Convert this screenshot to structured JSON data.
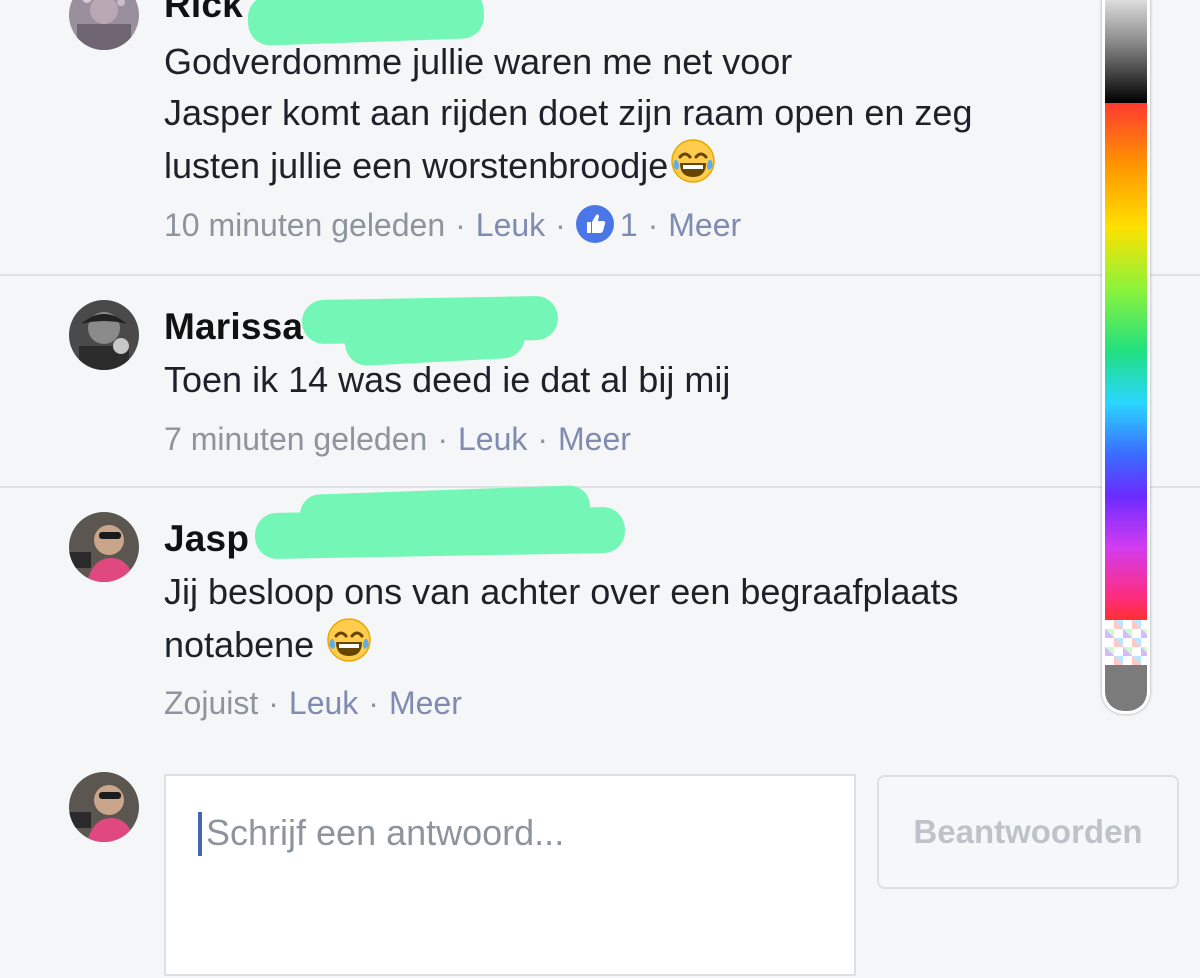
{
  "comments": [
    {
      "name": "Rick",
      "lines": [
        "Godverdomme jullie waren me net voor",
        "Jasper komt aan rijden doet zijn raam open en zeg",
        "lusten jullie een worstenbroodje"
      ],
      "meta": {
        "time": "10 minuten geleden",
        "like": "Leuk",
        "likes_count": "1",
        "more": "Meer"
      }
    },
    {
      "name": "Marissa",
      "lines": [
        "Toen ik 14 was deed ie dat al bij mij"
      ],
      "meta": {
        "time": "7 minuten geleden",
        "like": "Leuk",
        "more": "Meer"
      }
    },
    {
      "name": "Jasp",
      "lines": [
        "Jij besloop ons van achter over een begraafplaats",
        "notabene"
      ],
      "meta": {
        "time": "Zojuist",
        "like": "Leuk",
        "more": "Meer"
      }
    }
  ],
  "reply": {
    "placeholder": "Schrijf een antwoord...",
    "button": "Beantwoorden"
  },
  "icons": {
    "emoji": "laughing-tears-emoji-icon",
    "like_badge": "thumbs-up-icon"
  },
  "colors": {
    "redaction": "#74f6b6",
    "like_badge": "#4a76e8",
    "link": "#7f8bb0"
  }
}
